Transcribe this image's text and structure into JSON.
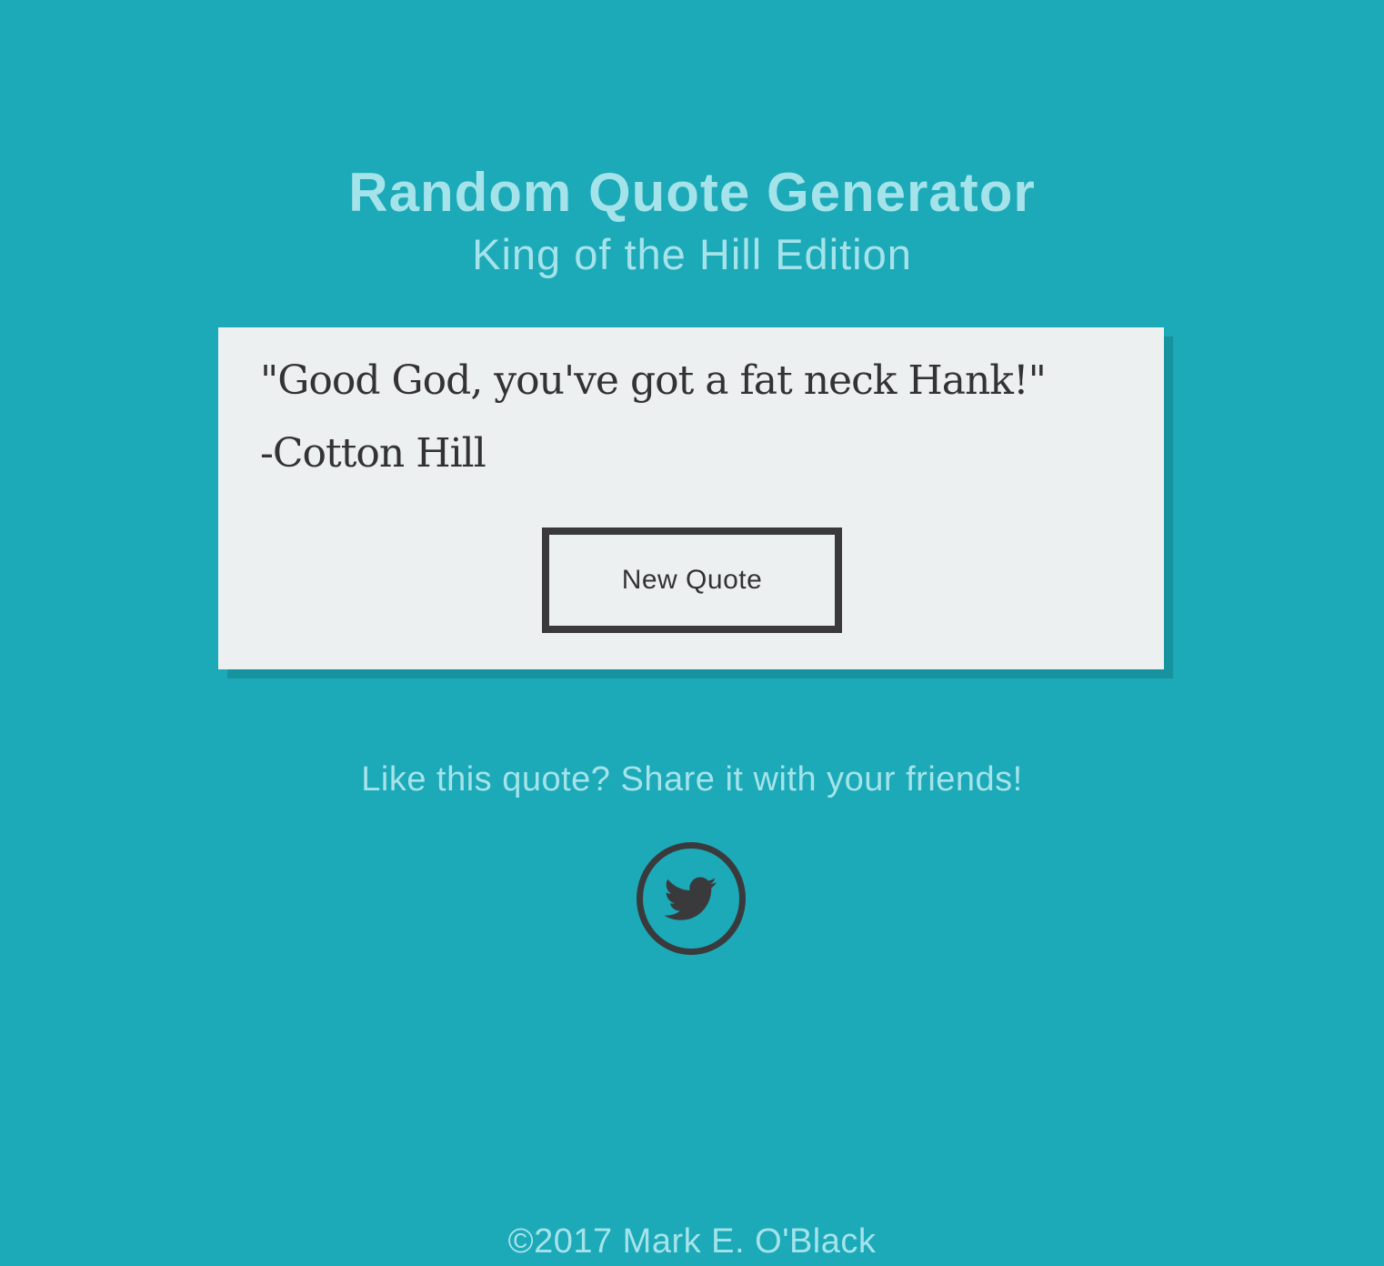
{
  "header": {
    "title": "Random Quote Generator",
    "subtitle": "King of the Hill Edition"
  },
  "quote": {
    "text": "\"Good God, you've got a fat neck Hank!\"",
    "author": "-Cotton Hill"
  },
  "actions": {
    "new_quote_label": "New Quote"
  },
  "share": {
    "prompt": "Like this quote? Share it with your friends!",
    "icon": "twitter-icon"
  },
  "footer": {
    "copyright": "©2017 Mark E. O'Black"
  },
  "colors": {
    "background": "#1ca9b8",
    "heading_text": "#a5e3ea",
    "card_background": "#edf0f1",
    "card_shadow": "#17929f",
    "dark": "#3a3a3c"
  }
}
